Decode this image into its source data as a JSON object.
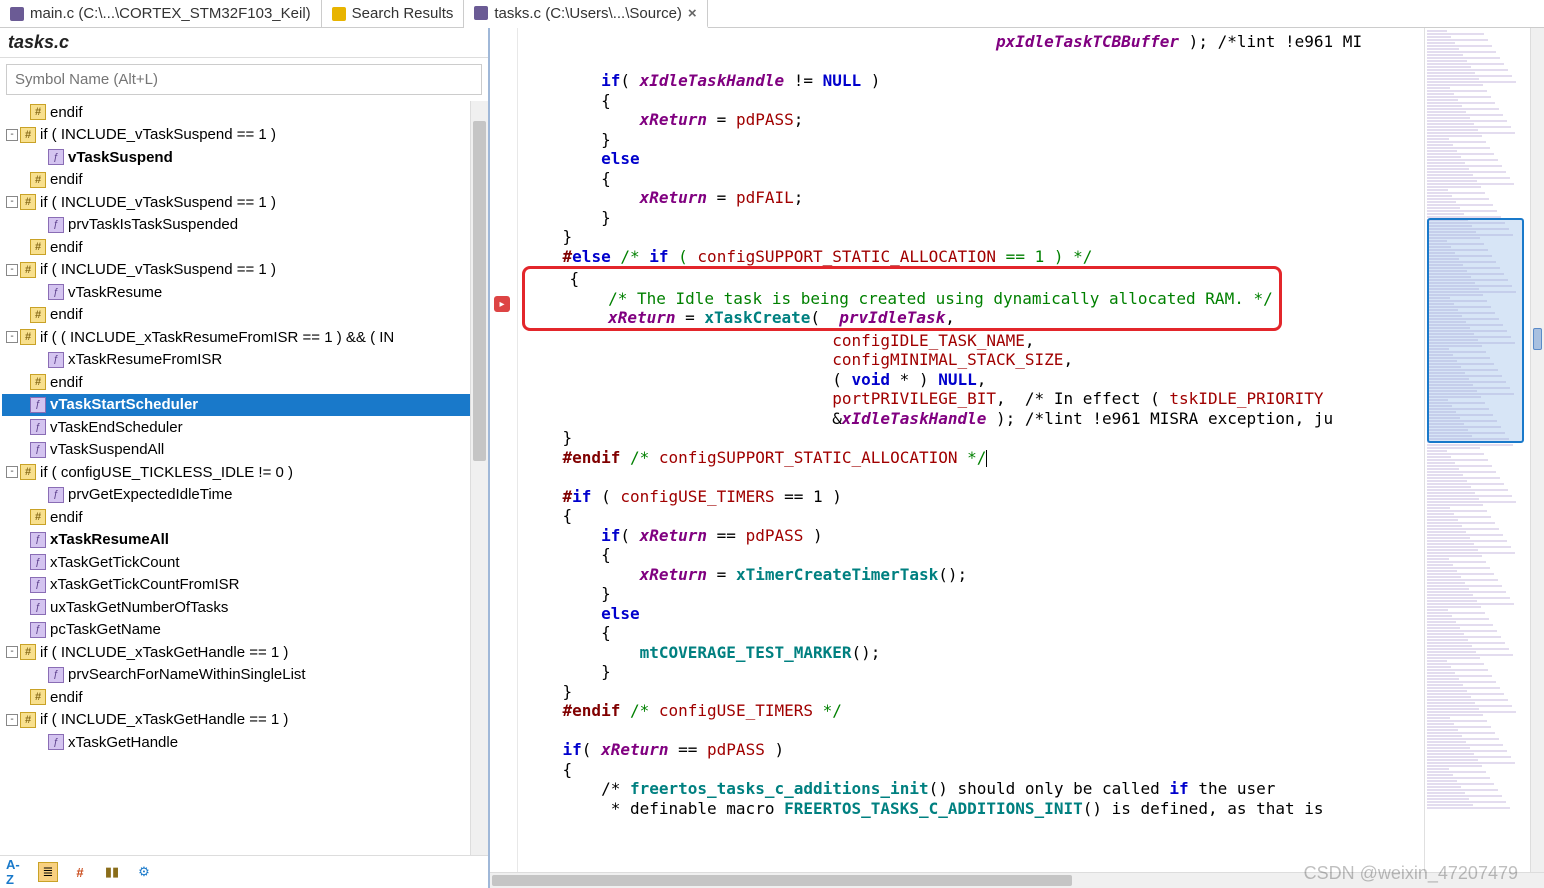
{
  "tabs": [
    {
      "label": "main.c (C:\\...\\CORTEX_STM32F103_Keil)",
      "icon": "c",
      "active": false,
      "closable": false
    },
    {
      "label": "Search Results",
      "icon": "sr",
      "active": false,
      "closable": false
    },
    {
      "label": "tasks.c (C:\\Users\\...\\Source)",
      "icon": "c",
      "active": true,
      "closable": true
    }
  ],
  "sidebar": {
    "title": "tasks.c",
    "search_placeholder": "Symbol Name (Alt+L)",
    "items": [
      {
        "depth": 1,
        "icon": "hash",
        "label": "endif"
      },
      {
        "depth": 0,
        "exp": "-",
        "icon": "hash",
        "label": "if ( INCLUDE_vTaskSuspend == 1 )"
      },
      {
        "depth": 2,
        "icon": "fn",
        "label": "vTaskSuspend",
        "bold": true
      },
      {
        "depth": 1,
        "icon": "hash",
        "label": "endif"
      },
      {
        "depth": 0,
        "exp": "-",
        "icon": "hash",
        "label": "if ( INCLUDE_vTaskSuspend == 1 )"
      },
      {
        "depth": 2,
        "icon": "fn",
        "label": "prvTaskIsTaskSuspended"
      },
      {
        "depth": 1,
        "icon": "hash",
        "label": "endif"
      },
      {
        "depth": 0,
        "exp": "-",
        "icon": "hash",
        "label": "if ( INCLUDE_vTaskSuspend == 1 )"
      },
      {
        "depth": 2,
        "icon": "fn",
        "label": "vTaskResume"
      },
      {
        "depth": 1,
        "icon": "hash",
        "label": "endif"
      },
      {
        "depth": 0,
        "exp": "-",
        "icon": "hash",
        "label": "if ( ( INCLUDE_xTaskResumeFromISR == 1 ) && ( IN"
      },
      {
        "depth": 2,
        "icon": "fn",
        "label": "xTaskResumeFromISR"
      },
      {
        "depth": 1,
        "icon": "hash",
        "label": "endif"
      },
      {
        "depth": 1,
        "icon": "fn",
        "label": "vTaskStartScheduler",
        "bold": true,
        "selected": true
      },
      {
        "depth": 1,
        "icon": "fn",
        "label": "vTaskEndScheduler"
      },
      {
        "depth": 1,
        "icon": "fn",
        "label": "vTaskSuspendAll"
      },
      {
        "depth": 0,
        "exp": "-",
        "icon": "hash",
        "label": "if ( configUSE_TICKLESS_IDLE != 0 )"
      },
      {
        "depth": 2,
        "icon": "fn",
        "label": "prvGetExpectedIdleTime"
      },
      {
        "depth": 1,
        "icon": "hash",
        "label": "endif"
      },
      {
        "depth": 1,
        "icon": "fn",
        "label": "xTaskResumeAll",
        "bold": true
      },
      {
        "depth": 1,
        "icon": "fn",
        "label": "xTaskGetTickCount"
      },
      {
        "depth": 1,
        "icon": "fn",
        "label": "xTaskGetTickCountFromISR"
      },
      {
        "depth": 1,
        "icon": "fn",
        "label": "uxTaskGetNumberOfTasks"
      },
      {
        "depth": 1,
        "icon": "fn",
        "label": "pcTaskGetName"
      },
      {
        "depth": 0,
        "exp": "-",
        "icon": "hash",
        "label": "if ( INCLUDE_xTaskGetHandle == 1 )"
      },
      {
        "depth": 2,
        "icon": "fn",
        "label": "prvSearchForNameWithinSingleList"
      },
      {
        "depth": 1,
        "icon": "hash",
        "label": "endif"
      },
      {
        "depth": 0,
        "exp": "-",
        "icon": "hash",
        "label": "if ( INCLUDE_xTaskGetHandle == 1 )"
      },
      {
        "depth": 2,
        "icon": "fn",
        "label": "xTaskGetHandle"
      }
    ],
    "toolbar": [
      "A-Z",
      "≣",
      "#",
      "▮▮",
      "⚙"
    ]
  },
  "code": {
    "lines": [
      {
        "t": "                                                 pxIdleTaskTCBBuffer ); /*lint !e961 MI",
        "cls": [
          "var",
          "cmt_tail"
        ]
      },
      {
        "t": ""
      },
      {
        "t": "        if( xIdleTaskHandle != NULL )"
      },
      {
        "t": "        {"
      },
      {
        "t": "            xReturn = pdPASS;"
      },
      {
        "t": "        }"
      },
      {
        "t": "        else"
      },
      {
        "t": "        {"
      },
      {
        "t": "            xReturn = pdFAIL;"
      },
      {
        "t": "        }"
      },
      {
        "t": "    }"
      },
      {
        "t": "    #else /* if ( configSUPPORT_STATIC_ALLOCATION == 1 ) */"
      },
      {
        "t": "    {",
        "box_start": true
      },
      {
        "t": "        /* The Idle task is being created using dynamically allocated RAM. */"
      },
      {
        "t": "        xReturn = xTaskCreate(  prvIdleTask,",
        "box_end": true
      },
      {
        "t": "                                configIDLE_TASK_NAME,"
      },
      {
        "t": "                                configMINIMAL_STACK_SIZE,"
      },
      {
        "t": "                                ( void * ) NULL,"
      },
      {
        "t": "                                portPRIVILEGE_BIT,  /* In effect ( tskIDLE_PRIORITY "
      },
      {
        "t": "                                &xIdleTaskHandle ); /*lint !e961 MISRA exception, ju"
      },
      {
        "t": "    }"
      },
      {
        "t": "    #endif /* configSUPPORT_STATIC_ALLOCATION */",
        "cursor": true
      },
      {
        "t": ""
      },
      {
        "t": "    #if ( configUSE_TIMERS == 1 )"
      },
      {
        "t": "    {"
      },
      {
        "t": "        if( xReturn == pdPASS )"
      },
      {
        "t": "        {"
      },
      {
        "t": "            xReturn = xTimerCreateTimerTask();"
      },
      {
        "t": "        }"
      },
      {
        "t": "        else"
      },
      {
        "t": "        {"
      },
      {
        "t": "            mtCOVERAGE_TEST_MARKER();"
      },
      {
        "t": "        }"
      },
      {
        "t": "    }"
      },
      {
        "t": "    #endif /* configUSE_TIMERS */"
      },
      {
        "t": ""
      },
      {
        "t": "    if( xReturn == pdPASS )"
      },
      {
        "t": "    {"
      },
      {
        "t": "        /* freertos_tasks_c_additions_init() should only be called if the user"
      },
      {
        "t": "         * definable macro FREERTOS_TASKS_C_ADDITIONS_INIT() is defined, as that is"
      }
    ]
  },
  "watermark": "CSDN @weixin_47207479"
}
